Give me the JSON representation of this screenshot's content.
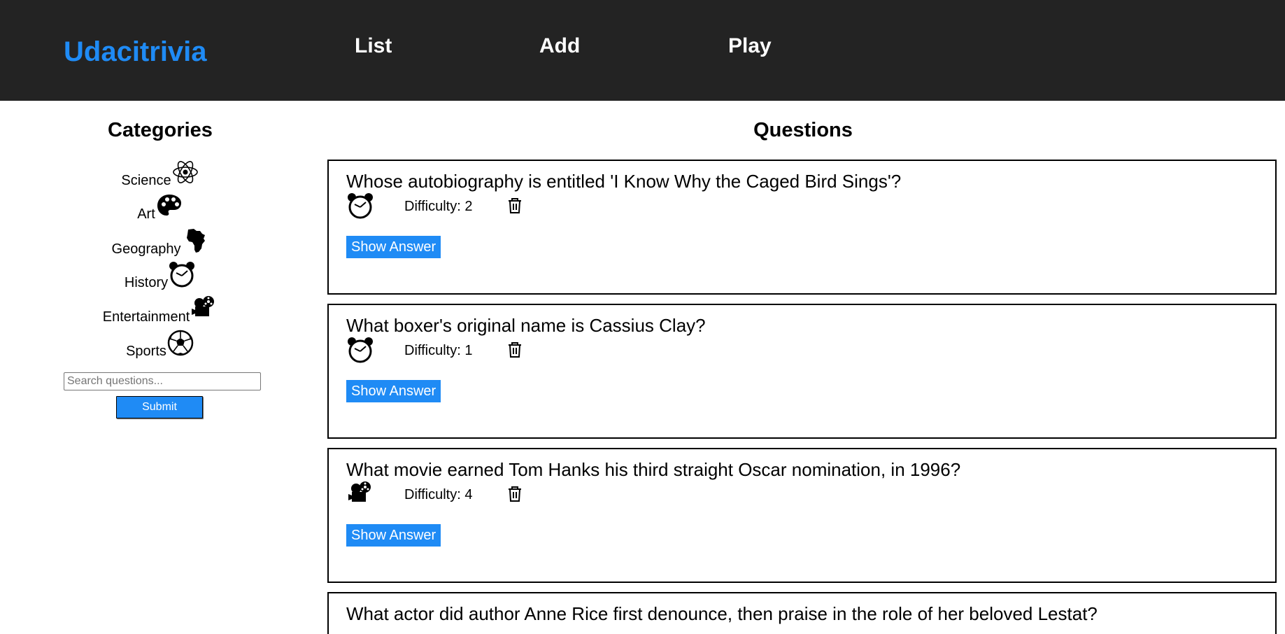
{
  "header": {
    "brand": "Udacitrivia",
    "nav": [
      {
        "label": "List"
      },
      {
        "label": "Add"
      },
      {
        "label": "Play"
      }
    ]
  },
  "sidebar": {
    "title": "Categories",
    "categories": [
      {
        "label": "Science",
        "icon": "atom-icon"
      },
      {
        "label": "Art",
        "icon": "palette-icon"
      },
      {
        "label": "Geography",
        "icon": "africa-icon"
      },
      {
        "label": "History",
        "icon": "alarm-clock-icon"
      },
      {
        "label": "Entertainment",
        "icon": "film-projector-icon"
      },
      {
        "label": "Sports",
        "icon": "soccer-ball-icon"
      }
    ],
    "search": {
      "placeholder": "Search questions...",
      "value": ""
    },
    "submit_label": "Submit"
  },
  "main": {
    "title": "Questions",
    "questions": [
      {
        "text": "Whose autobiography is entitled 'I Know Why the Caged Bird Sings'?",
        "category_icon": "alarm-clock-icon",
        "difficulty": "Difficulty: 2",
        "show_answer_label": "Show Answer"
      },
      {
        "text": "What boxer's original name is Cassius Clay?",
        "category_icon": "alarm-clock-icon",
        "difficulty": "Difficulty: 1",
        "show_answer_label": "Show Answer"
      },
      {
        "text": "What movie earned Tom Hanks his third straight Oscar nomination, in 1996?",
        "category_icon": "film-projector-icon",
        "difficulty": "Difficulty: 4",
        "show_answer_label": "Show Answer"
      },
      {
        "text": "What actor did author Anne Rice first denounce, then praise in the role of her beloved Lestat?",
        "category_icon": "film-projector-icon",
        "difficulty": "",
        "show_answer_label": ""
      }
    ]
  },
  "colors": {
    "header_bg": "#232323",
    "brand": "#1f8bf5",
    "accent": "#1f8bf5"
  }
}
